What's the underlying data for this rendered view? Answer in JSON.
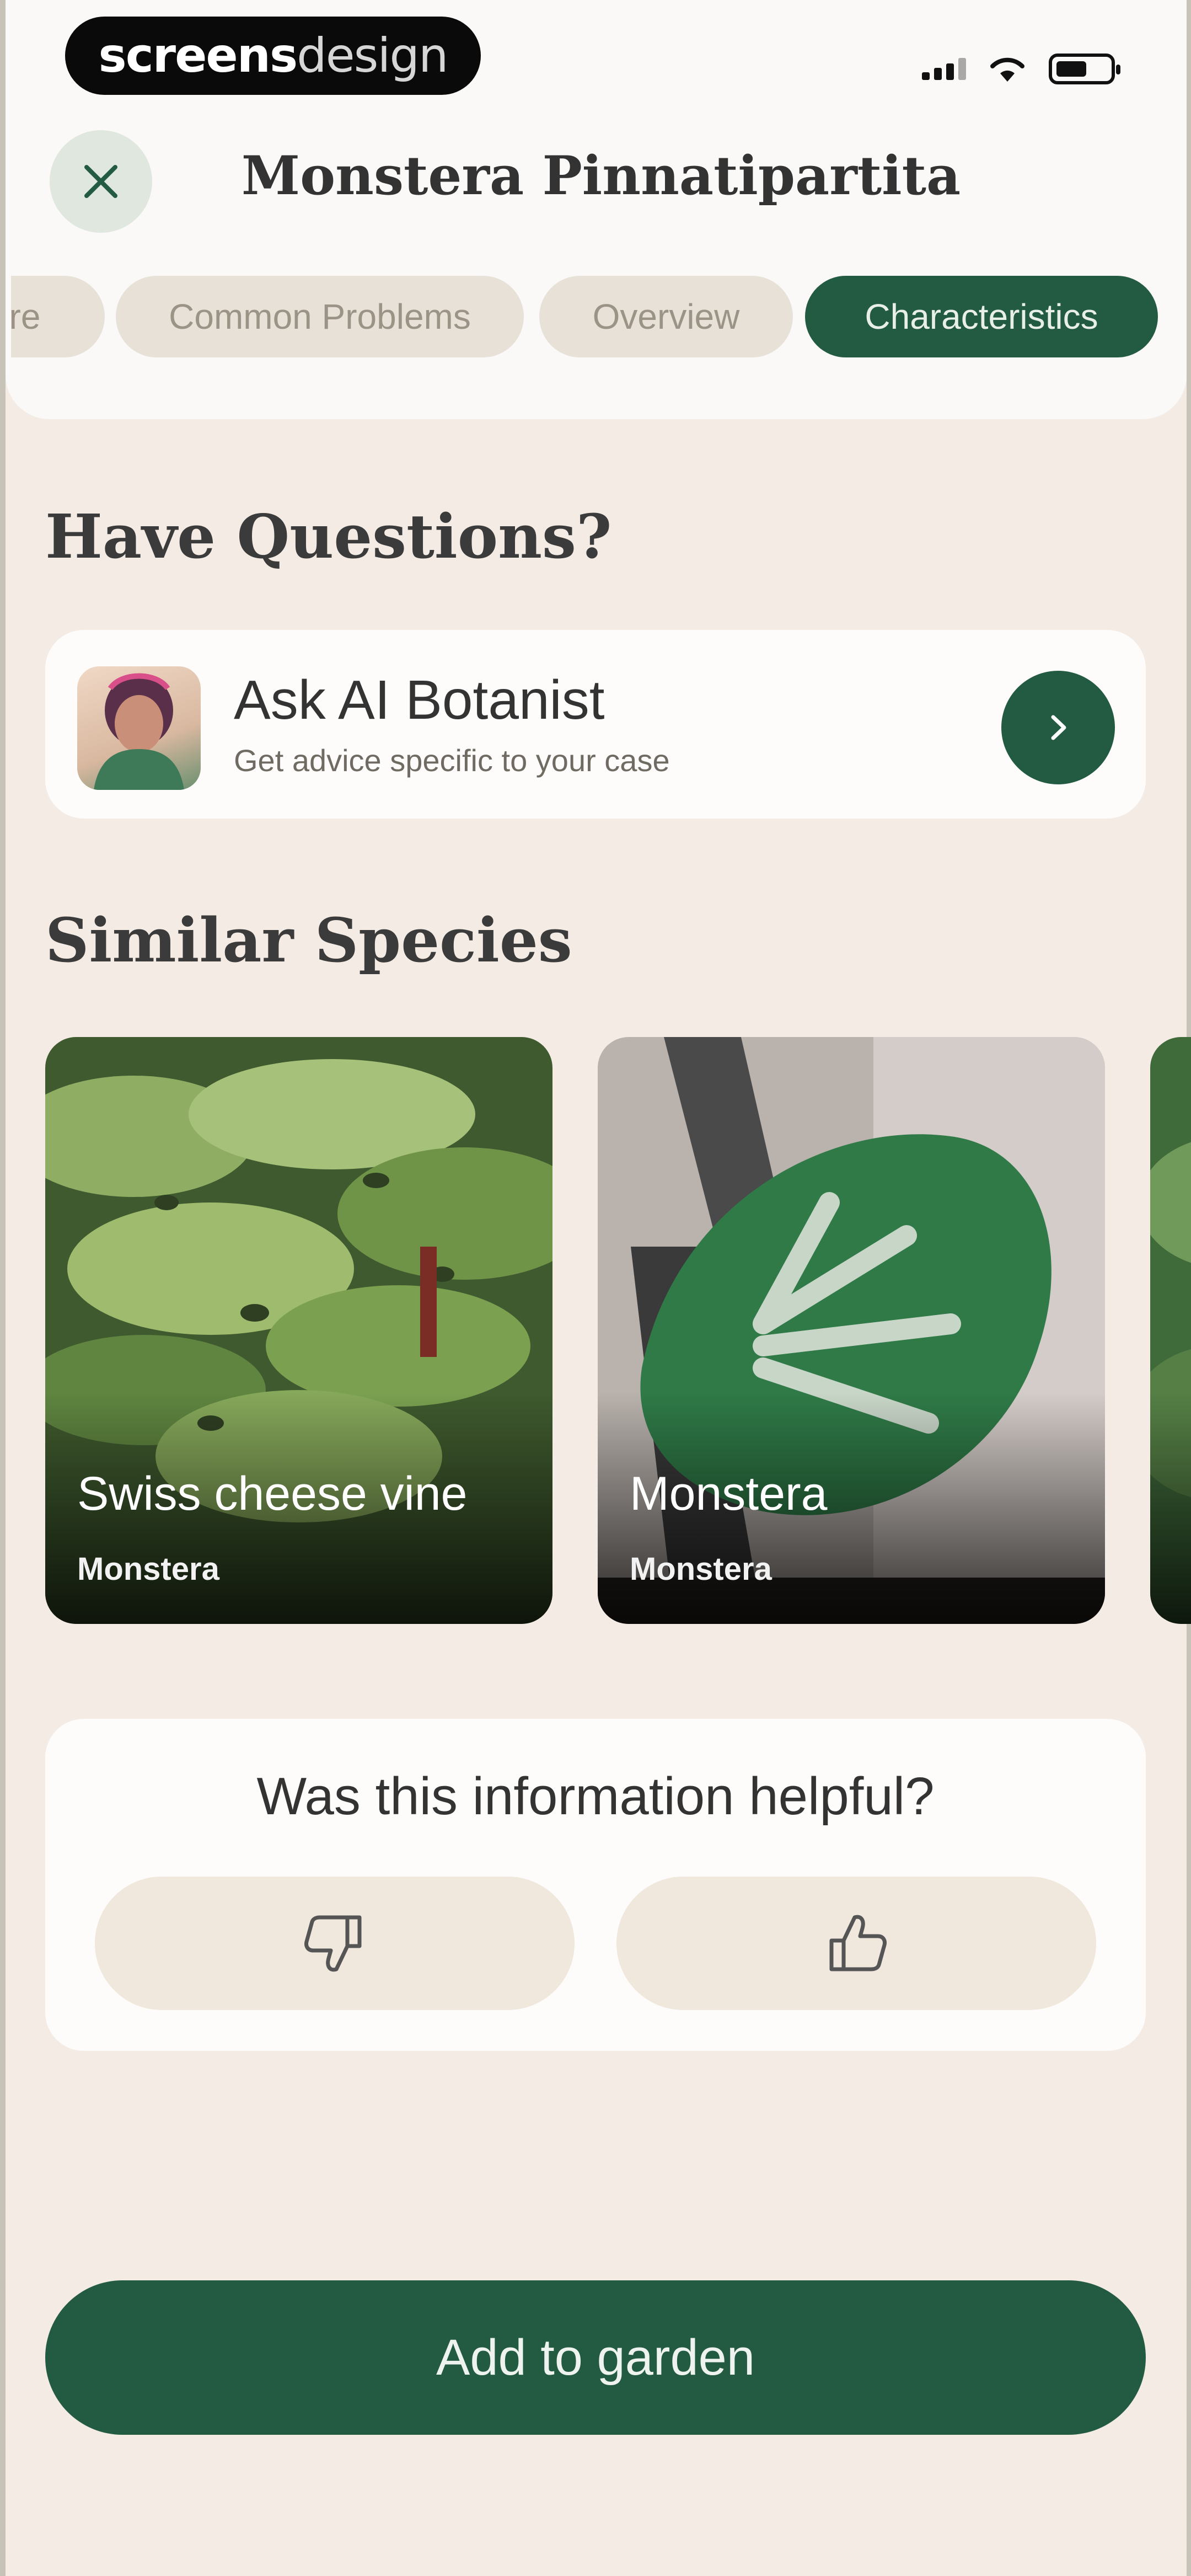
{
  "status_bar": {
    "brand": {
      "bold": "screens",
      "light": "design"
    },
    "icons": [
      "cellular-signal-icon",
      "wifi-icon",
      "battery-icon"
    ]
  },
  "header": {
    "close_icon": "close-icon",
    "title": "Monstera Pinnatipartita"
  },
  "tabs": [
    {
      "label": "re",
      "active": false
    },
    {
      "label": "Common Problems",
      "active": false
    },
    {
      "label": "Overview",
      "active": false
    },
    {
      "label": "Characteristics",
      "active": true
    }
  ],
  "questions": {
    "heading": "Have Questions?",
    "card": {
      "title": "Ask AI Botanist",
      "subtitle": "Get advice specific to your case",
      "arrow_icon": "chevron-right-icon"
    }
  },
  "similar": {
    "heading": "Similar Species",
    "items": [
      {
        "name": "Swiss cheese vine",
        "genus": "Monstera"
      },
      {
        "name": "Monstera",
        "genus": "Monstera"
      }
    ]
  },
  "feedback": {
    "question": "Was this information helpful?",
    "dislike_icon": "thumbs-down-icon",
    "like_icon": "thumbs-up-icon"
  },
  "cta": {
    "label": "Add to garden"
  },
  "colors": {
    "accent": "#235b42",
    "background": "#f3ebe4",
    "card": "#fdfcfa",
    "chip": "#e7e1d8"
  }
}
